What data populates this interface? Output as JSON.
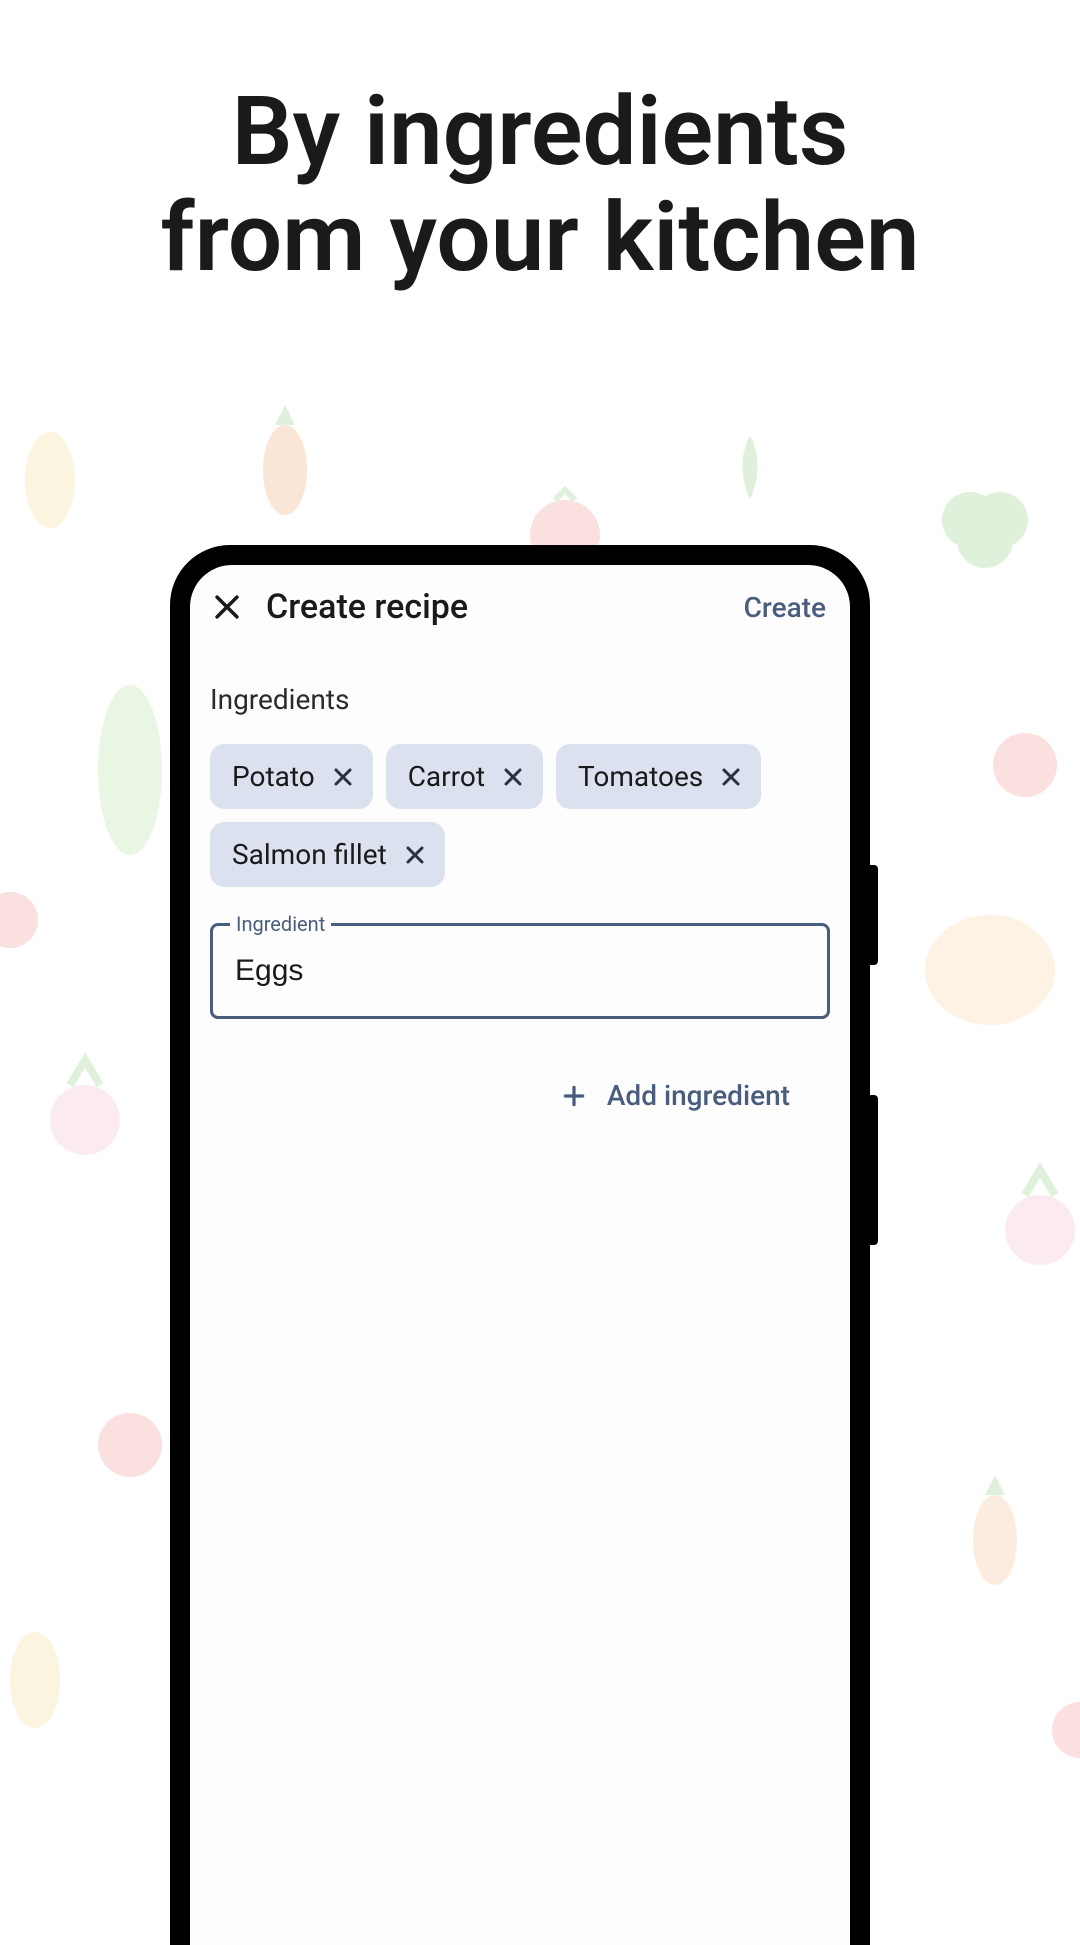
{
  "heading": {
    "line1": "By ingredients",
    "line2": "from your kitchen"
  },
  "appbar": {
    "title": "Create recipe",
    "create_label": "Create"
  },
  "section_label": "Ingredients",
  "chips": [
    {
      "label": "Potato"
    },
    {
      "label": "Carrot"
    },
    {
      "label": "Tomatoes"
    },
    {
      "label": "Salmon fillet"
    }
  ],
  "input": {
    "label": "Ingredient",
    "value": "Eggs"
  },
  "add_button_label": "Add ingredient",
  "colors": {
    "accent": "#4a5d7e",
    "chip_bg": "#dbe1ee"
  }
}
